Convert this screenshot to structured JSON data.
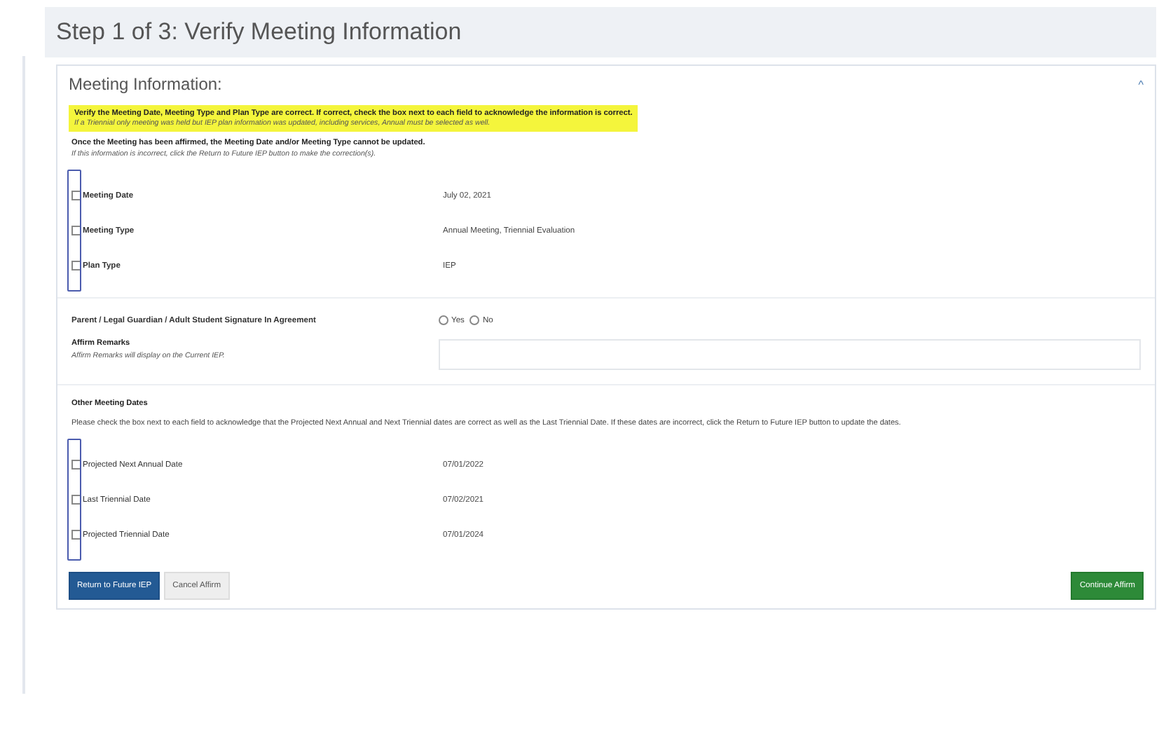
{
  "page_title": "Step 1 of 3: Verify Meeting Information",
  "section": {
    "title": "Meeting Information:",
    "expanded": true,
    "toggle": "^"
  },
  "notice": {
    "heading": "Verify the Meeting Date, Meeting Type and Plan Type are correct. If correct, check the box next to each field to acknowledge the information is correct.",
    "note": "If a Triennial only meeting was held but IEP plan information was updated, including services, Annual must be selected as well."
  },
  "warning": {
    "heading": "Once the Meeting has been affirmed, the Meeting Date and/or Meeting Type cannot be updated.",
    "note": "If this information is incorrect, click the Return to Future IEP button to make the correction(s)."
  },
  "meeting_fields": [
    {
      "label": "Meeting Date",
      "value": "July 02, 2021",
      "checked": false
    },
    {
      "label": "Meeting Type",
      "value": "Annual Meeting, Triennial Evaluation",
      "checked": false
    },
    {
      "label": "Plan Type",
      "value": "IEP",
      "checked": false
    }
  ],
  "signature": {
    "label": "Parent / Legal Guardian / Adult Student Signature In Agreement",
    "options": [
      {
        "label": "Yes",
        "selected": false
      },
      {
        "label": "No",
        "selected": false
      }
    ]
  },
  "remarks": {
    "label": "Affirm Remarks",
    "note": "Affirm Remarks will display on the Current IEP."
  },
  "other_dates": {
    "title": "Other Meeting Dates",
    "instructions": "Please check the box next to each field to acknowledge that the Projected Next Annual and Next Triennial dates are correct as well as the Last Triennial Date. If these dates are incorrect, click the Return to Future IEP button to update the dates.",
    "fields": [
      {
        "label": "Projected Next Annual Date",
        "value": "07/01/2022",
        "checked": false
      },
      {
        "label": "Last Triennial Date",
        "value": "07/02/2021",
        "checked": false
      },
      {
        "label": "Projected Triennial Date",
        "value": "07/01/2024",
        "checked": false
      }
    ]
  },
  "buttons": [
    {
      "label": "Return to Future IEP",
      "kind": "primary"
    },
    {
      "label": "Cancel Affirm",
      "kind": "secondary"
    },
    {
      "label": "Continue Affirm",
      "kind": "success"
    }
  ]
}
